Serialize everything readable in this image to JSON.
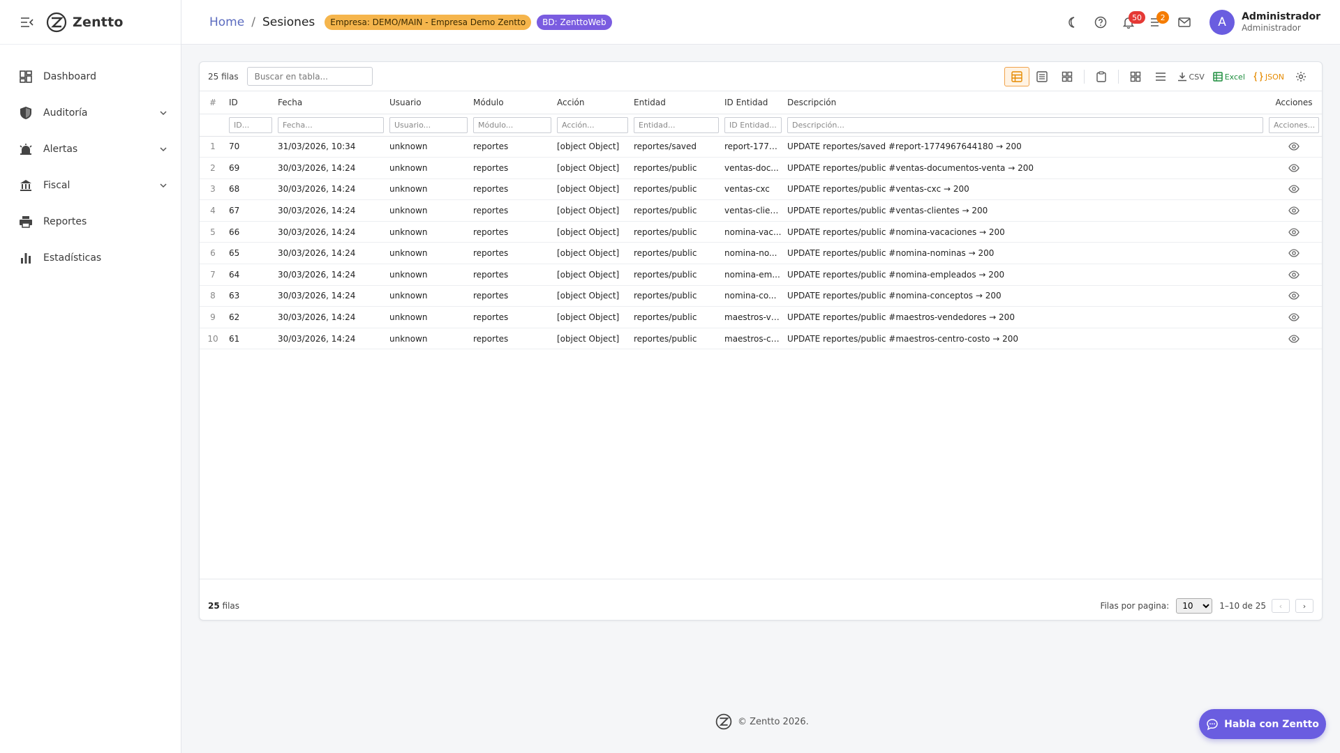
{
  "brand": {
    "name": "Zentto"
  },
  "sidebar": {
    "items": [
      {
        "label": "Dashboard",
        "icon": "dashboard-icon",
        "has_children": false
      },
      {
        "label": "Auditoría",
        "icon": "shield-icon",
        "has_children": true
      },
      {
        "label": "Alertas",
        "icon": "alarm-icon",
        "has_children": true
      },
      {
        "label": "Fiscal",
        "icon": "bank-icon",
        "has_children": true
      },
      {
        "label": "Reportes",
        "icon": "printer-icon",
        "has_children": false
      },
      {
        "label": "Estadísticas",
        "icon": "bar-chart-icon",
        "has_children": false
      }
    ]
  },
  "header": {
    "breadcrumb": {
      "home": "Home",
      "separator": "/",
      "current": "Sesiones"
    },
    "empresa_chip": "Empresa: DEMO/MAIN - Empresa Demo Zentto",
    "bd_chip": "BD: ZenttoWeb",
    "notifications_count": "50",
    "tasks_count": "2",
    "user": {
      "initial": "A",
      "name": "Administrador",
      "role": "Administrador"
    }
  },
  "table": {
    "row_count_label": "25 filas",
    "search_placeholder": "Buscar en tabla...",
    "toolbar": {
      "csv": "CSV",
      "excel": "Excel",
      "json": "JSON"
    },
    "columns": [
      {
        "label": "#",
        "filter": ""
      },
      {
        "label": "ID",
        "filter": "ID..."
      },
      {
        "label": "Fecha",
        "filter": "Fecha..."
      },
      {
        "label": "Usuario",
        "filter": "Usuario..."
      },
      {
        "label": "Módulo",
        "filter": "Módulo..."
      },
      {
        "label": "Acción",
        "filter": "Acción..."
      },
      {
        "label": "Entidad",
        "filter": "Entidad..."
      },
      {
        "label": "ID Entidad",
        "filter": "ID Entidad..."
      },
      {
        "label": "Descripción",
        "filter": "Descripción..."
      },
      {
        "label": "Acciones",
        "filter": "Acciones..."
      }
    ],
    "rows": [
      [
        "1",
        "70",
        "31/03/2026, 10:34",
        "unknown",
        "reportes",
        "[object Object]",
        "reportes/saved",
        "report-1774...",
        "UPDATE reportes/saved #report-1774967644180 → 200"
      ],
      [
        "2",
        "69",
        "30/03/2026, 14:24",
        "unknown",
        "reportes",
        "[object Object]",
        "reportes/public",
        "ventas-doc...",
        "UPDATE reportes/public #ventas-documentos-venta → 200"
      ],
      [
        "3",
        "68",
        "30/03/2026, 14:24",
        "unknown",
        "reportes",
        "[object Object]",
        "reportes/public",
        "ventas-cxc",
        "UPDATE reportes/public #ventas-cxc → 200"
      ],
      [
        "4",
        "67",
        "30/03/2026, 14:24",
        "unknown",
        "reportes",
        "[object Object]",
        "reportes/public",
        "ventas-clien...",
        "UPDATE reportes/public #ventas-clientes → 200"
      ],
      [
        "5",
        "66",
        "30/03/2026, 14:24",
        "unknown",
        "reportes",
        "[object Object]",
        "reportes/public",
        "nomina-vac...",
        "UPDATE reportes/public #nomina-vacaciones → 200"
      ],
      [
        "6",
        "65",
        "30/03/2026, 14:24",
        "unknown",
        "reportes",
        "[object Object]",
        "reportes/public",
        "nomina-no...",
        "UPDATE reportes/public #nomina-nominas → 200"
      ],
      [
        "7",
        "64",
        "30/03/2026, 14:24",
        "unknown",
        "reportes",
        "[object Object]",
        "reportes/public",
        "nomina-em...",
        "UPDATE reportes/public #nomina-empleados → 200"
      ],
      [
        "8",
        "63",
        "30/03/2026, 14:24",
        "unknown",
        "reportes",
        "[object Object]",
        "reportes/public",
        "nomina-co...",
        "UPDATE reportes/public #nomina-conceptos → 200"
      ],
      [
        "9",
        "62",
        "30/03/2026, 14:24",
        "unknown",
        "reportes",
        "[object Object]",
        "reportes/public",
        "maestros-ve...",
        "UPDATE reportes/public #maestros-vendedores → 200"
      ],
      [
        "10",
        "61",
        "30/03/2026, 14:24",
        "unknown",
        "reportes",
        "[object Object]",
        "reportes/public",
        "maestros-ce...",
        "UPDATE reportes/public #maestros-centro-costo → 200"
      ]
    ],
    "footer": {
      "count_number": "25",
      "count_suffix": "filas",
      "rows_per_page_label": "Filas por pagina:",
      "rows_per_page_value": "10",
      "range": "1–10 de 25",
      "prev": "‹",
      "next": "›"
    }
  },
  "page_footer": {
    "copyright": "© Zentto 2026."
  },
  "chat_button": {
    "label": "Habla con Zentto"
  },
  "colors": {
    "accent": "#6a5de0",
    "empresa_chip": "#f5b54c",
    "bd_chip": "#7a5ce0",
    "notif_badge": "#e53935",
    "task_badge": "#f57c00",
    "excel": "#1e8e3e",
    "json": "#e58a00"
  }
}
